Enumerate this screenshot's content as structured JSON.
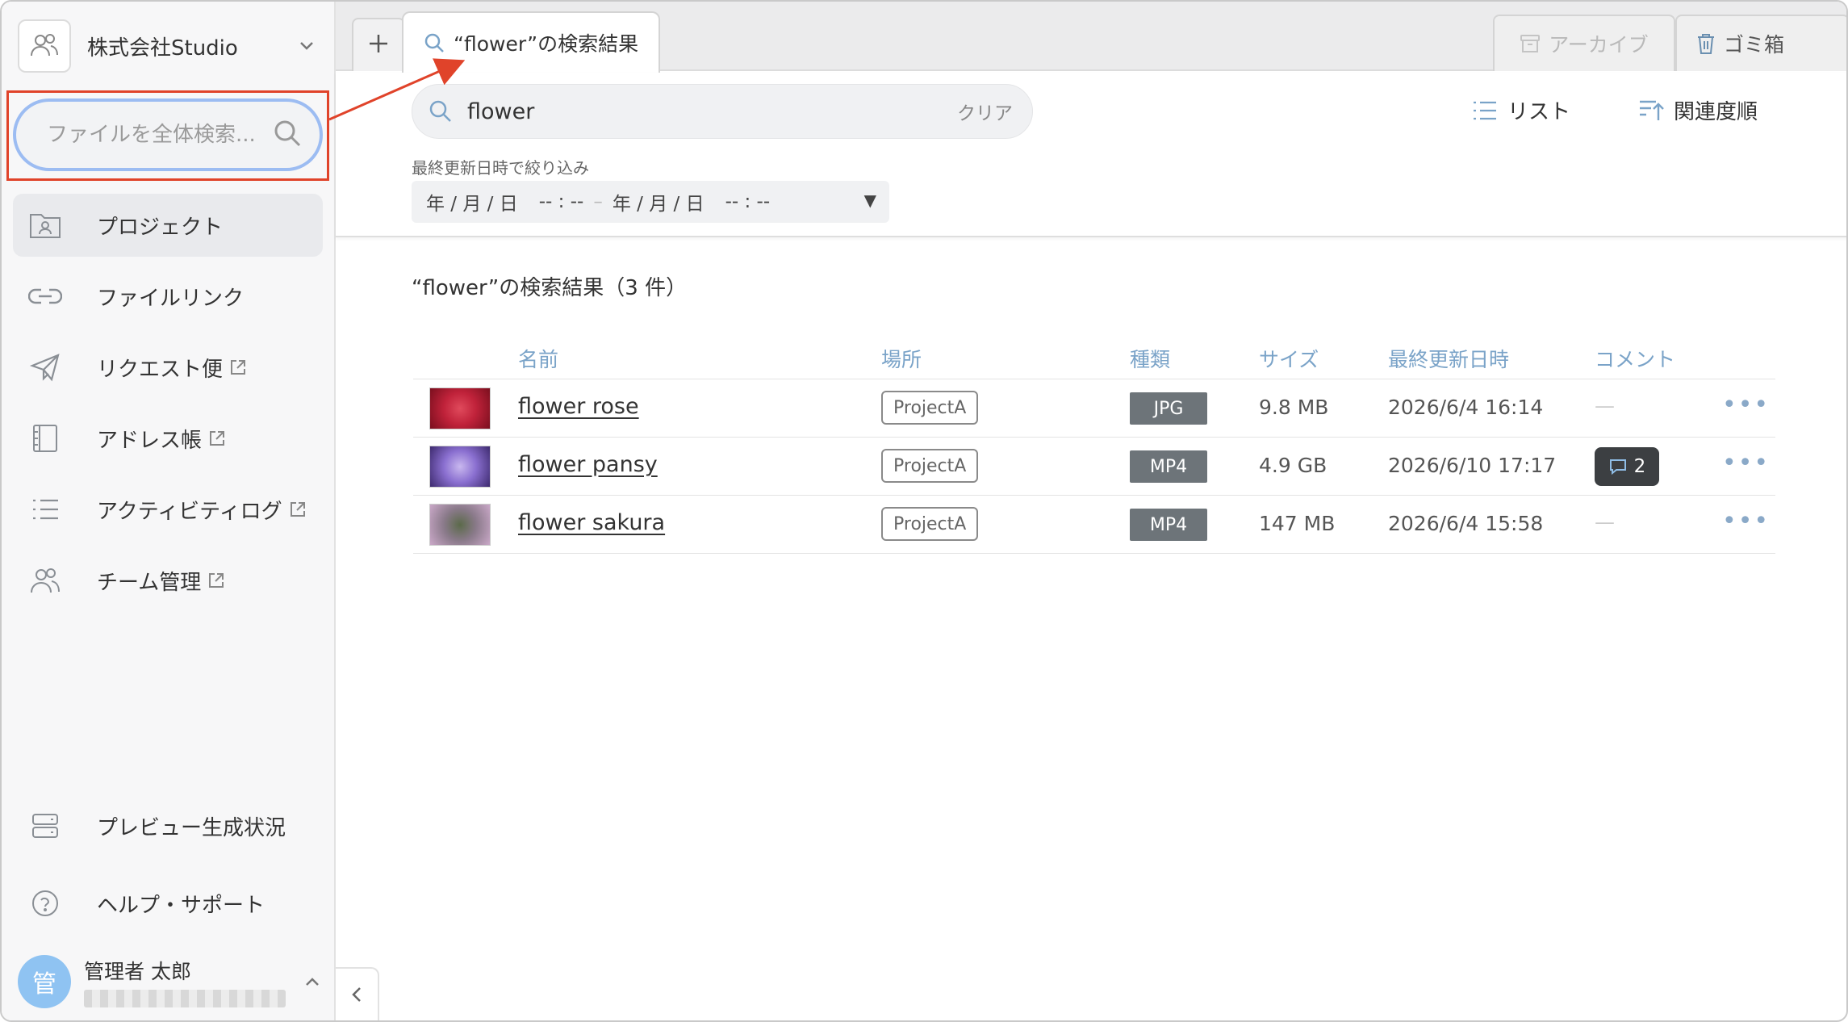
{
  "sidebar": {
    "org_name": "株式会社Studio",
    "search_placeholder": "ファイルを全体検索...",
    "nav": [
      {
        "label": "プロジェクト",
        "icon": "project-folder-icon",
        "external": false
      },
      {
        "label": "ファイルリンク",
        "icon": "link-icon",
        "external": false
      },
      {
        "label": "リクエスト便",
        "icon": "paper-plane-icon",
        "external": true
      },
      {
        "label": "アドレス帳",
        "icon": "address-book-icon",
        "external": true
      },
      {
        "label": "アクティビティログ",
        "icon": "list-icon",
        "external": true
      },
      {
        "label": "チーム管理",
        "icon": "team-icon",
        "external": true
      }
    ],
    "bottom_nav": [
      {
        "label": "プレビュー生成状況",
        "icon": "server-icon"
      },
      {
        "label": "ヘルプ・サポート",
        "icon": "help-icon"
      }
    ],
    "user": {
      "avatar": "管",
      "name": "管理者 太郎"
    }
  },
  "tabs": {
    "add_label": "+",
    "active_label": "“flower”の検索結果",
    "archive_label": "アーカイブ",
    "trash_label": "ゴミ箱"
  },
  "filter": {
    "query": "flower",
    "clear_label": "クリア",
    "view_label": "リスト",
    "sort_label": "関連度順",
    "date_label": "最終更新日時で絞り込み",
    "date_from": "年 / 月 / 日",
    "time_from": "-- : --",
    "range_sep": "–",
    "date_to": "年 / 月 / 日",
    "time_to": "-- : --",
    "dropdown_arrow": "▼"
  },
  "results": {
    "title": "“flower”の検索結果（3 件）",
    "columns": [
      "名前",
      "場所",
      "種類",
      "サイズ",
      "最終更新日時",
      "コメント"
    ],
    "rows": [
      {
        "name": "flower rose",
        "location": "ProjectA",
        "type": "JPG",
        "size": "9.8 MB",
        "date": "2026/6/4 16:14",
        "comments": "—",
        "has_comments": false,
        "thumb_colors": [
          "#7a0f1e",
          "#c0223a",
          "#e04a5c"
        ]
      },
      {
        "name": "flower pansy",
        "location": "ProjectA",
        "type": "MP4",
        "size": "4.9 GB",
        "date": "2026/6/10 17:17",
        "comments": "2",
        "has_comments": true,
        "thumb_colors": [
          "#3d2a6e",
          "#8a6fd0",
          "#c9b8ef"
        ]
      },
      {
        "name": "flower sakura",
        "location": "ProjectA",
        "type": "MP4",
        "size": "147 MB",
        "date": "2026/6/4 15:58",
        "comments": "—",
        "has_comments": false,
        "thumb_colors": [
          "#caa8c8",
          "#8a7a8a",
          "#5b6a4a"
        ]
      }
    ],
    "more_label": "•••"
  },
  "colors": {
    "accent_blue": "#7aa3c8",
    "highlight_red": "#e0432a",
    "type_badge": "#6d7479",
    "comment_badge": "#3c3f42"
  }
}
